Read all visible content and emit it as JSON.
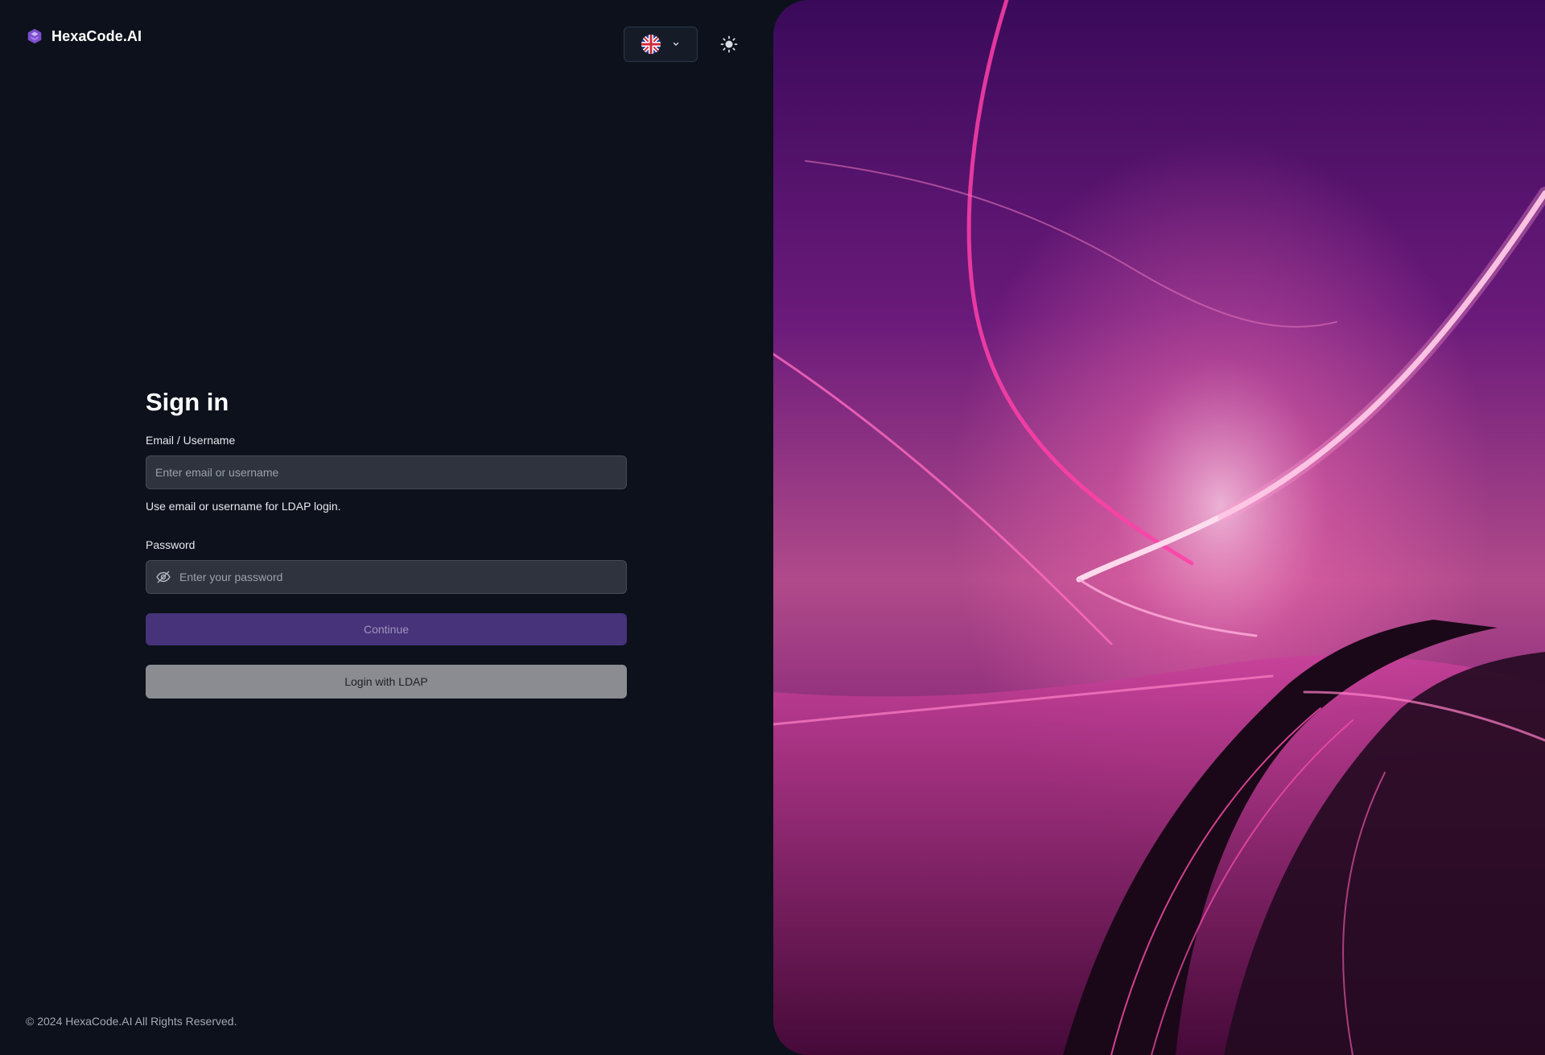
{
  "brand": {
    "name": "HexaCode.AI",
    "logo_icon": "hexagon-logo-icon"
  },
  "header": {
    "language_icon": "uk-flag-icon",
    "dropdown_icon": "chevron-down-icon",
    "theme_icon": "sun-icon"
  },
  "form": {
    "title": "Sign in",
    "email_label": "Email / Username",
    "email_placeholder": "Enter email or username",
    "email_hint": "Use email or username for LDAP login.",
    "password_label": "Password",
    "password_placeholder": "Enter your password",
    "password_toggle_icon": "eye-off-icon",
    "continue_label": "Continue",
    "ldap_label": "Login with LDAP"
  },
  "footer": {
    "copyright": "© 2024  HexaCode.AI All Rights Reserved."
  },
  "colors": {
    "accent": "#46337a",
    "background": "#0c111b",
    "hero_magenta": "#e0208f"
  }
}
